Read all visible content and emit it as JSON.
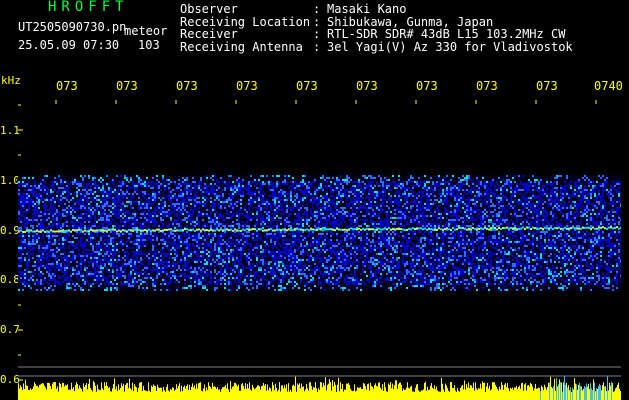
{
  "header": {
    "app_title": "HROFFT",
    "file_name": "UT2505090730.pn",
    "tag": "meteor",
    "date_time": "25.05.09 07:30",
    "frequency": "103"
  },
  "station_info": {
    "labels": [
      "Observer",
      "Receiving Location",
      "Receiver",
      "Receiving Antenna"
    ],
    "values": [
      "Masaki Kano",
      "Shibukawa, Gunma, Japan",
      "RTL-SDR SDR# 43dB L15 103.2MHz CW",
      "3el Yagi(V) Az 330 for Vladivostok"
    ]
  },
  "chart_data": {
    "type": "heatmap",
    "ylabel": "kHz",
    "x_tick_labels": [
      "073",
      "073",
      "073",
      "073",
      "073",
      "073",
      "073",
      "073",
      "073",
      "0740"
    ],
    "y_tick_labels": [
      "1.1",
      "1.0",
      "0.9",
      "0.8",
      "0.7",
      "0.6"
    ],
    "ylim": [
      0.6,
      1.15
    ],
    "signal_band_khz": [
      0.78,
      1.01
    ],
    "carrier_line_khz": 0.9,
    "colors": {
      "background": "#000000",
      "noise_low": "#0000c8",
      "noise_mid": "#2f6bff",
      "noise_high": "#00e0e0",
      "carrier": "#b4ff50",
      "axis_text": "#ffff00",
      "bottom_bars": "#ffff00",
      "bottom_bars_alt": "#40c0ff"
    }
  }
}
